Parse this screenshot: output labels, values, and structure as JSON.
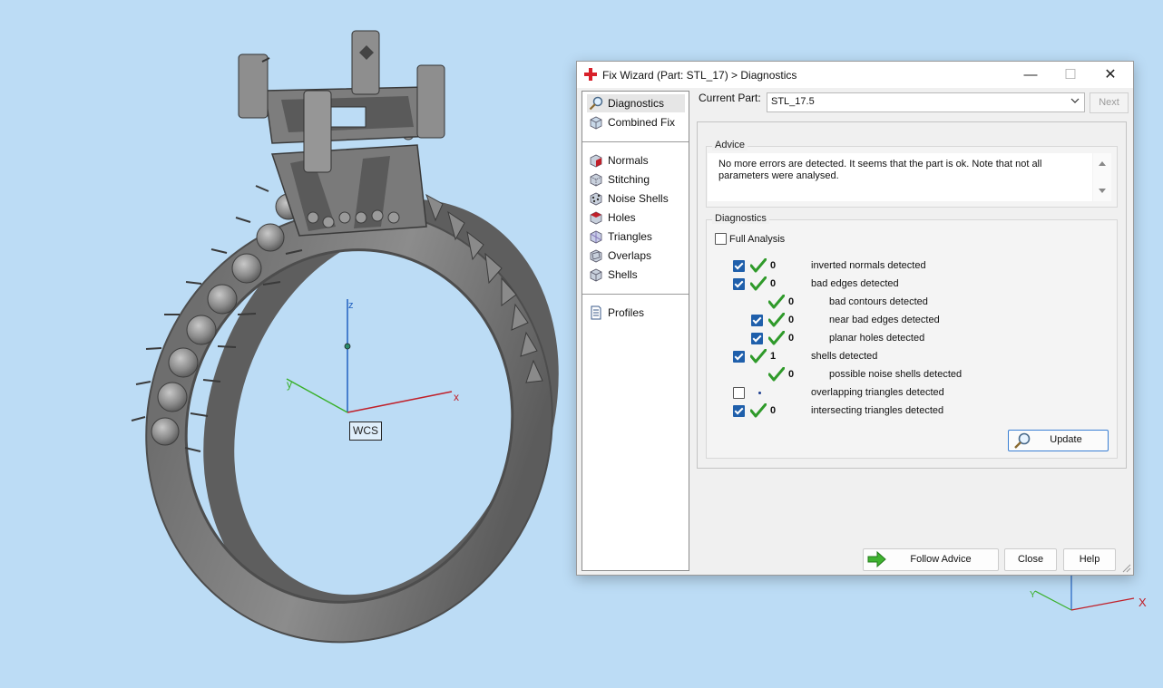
{
  "viewport": {
    "wcs_label": "WCS",
    "axis_labels": {
      "x": "x",
      "y": "y",
      "z": "z"
    },
    "mini_axis_labels": {
      "x": "X",
      "y": "Y"
    },
    "colors": {
      "background": "#bcdcf5",
      "axis_x": "#c0202a",
      "axis_y": "#39b02a",
      "axis_z": "#2060c0",
      "model": "#7a7a7a"
    }
  },
  "dialog": {
    "title": "Fix Wizard (Part: STL_17) > Diagnostics",
    "title_icon": "red-cross-icon",
    "nav": {
      "top_items": [
        {
          "label": "Diagnostics",
          "icon": "magnifier-icon",
          "selected": true
        },
        {
          "label": "Combined Fix",
          "icon": "cube-icon"
        }
      ],
      "tool_items": [
        {
          "label": "Normals",
          "icon": "normals-cube-icon"
        },
        {
          "label": "Stitching",
          "icon": "stitching-cube-icon"
        },
        {
          "label": "Noise Shells",
          "icon": "noise-shells-cube-icon"
        },
        {
          "label": "Holes",
          "icon": "holes-cube-icon"
        },
        {
          "label": "Triangles",
          "icon": "triangles-cube-icon"
        },
        {
          "label": "Overlaps",
          "icon": "overlaps-cube-icon"
        },
        {
          "label": "Shells",
          "icon": "shells-cube-icon"
        }
      ],
      "bottom_items": [
        {
          "label": "Profiles",
          "icon": "document-icon"
        }
      ]
    },
    "current_part": {
      "label": "Current Part:",
      "value": "STL_17.5"
    },
    "next_label": "Next",
    "advice": {
      "title": "Advice",
      "text": "No more errors are detected. It seems that the part is ok. Note that not all parameters were analysed."
    },
    "diagnostics": {
      "title": "Diagnostics",
      "full_analysis": {
        "label": "Full Analysis",
        "checked": false
      },
      "rows": [
        {
          "checkbox": "checked",
          "status": "ok",
          "count": "0",
          "label": "inverted normals detected",
          "indent": 0
        },
        {
          "checkbox": "checked",
          "status": "ok",
          "count": "0",
          "label": "bad edges detected",
          "indent": 0
        },
        {
          "checkbox": "none",
          "status": "ok",
          "count": "0",
          "label": "bad contours detected",
          "indent": 1
        },
        {
          "checkbox": "checked",
          "status": "ok",
          "count": "0",
          "label": "near bad edges detected",
          "indent": 1
        },
        {
          "checkbox": "checked",
          "status": "ok",
          "count": "0",
          "label": "planar holes detected",
          "indent": 1
        },
        {
          "checkbox": "checked",
          "status": "ok",
          "count": "1",
          "label": "shells detected",
          "indent": 0
        },
        {
          "checkbox": "none",
          "status": "ok",
          "count": "0",
          "label": "possible noise shells detected",
          "indent": 1
        },
        {
          "checkbox": "unchecked",
          "status": "dot",
          "count": "",
          "label": "overlapping triangles detected",
          "indent": 0
        },
        {
          "checkbox": "checked",
          "status": "ok",
          "count": "0",
          "label": "intersecting triangles detected",
          "indent": 0
        }
      ],
      "update_label": "Update"
    },
    "buttons": {
      "follow_advice": "Follow Advice",
      "close": "Close",
      "help": "Help"
    }
  }
}
